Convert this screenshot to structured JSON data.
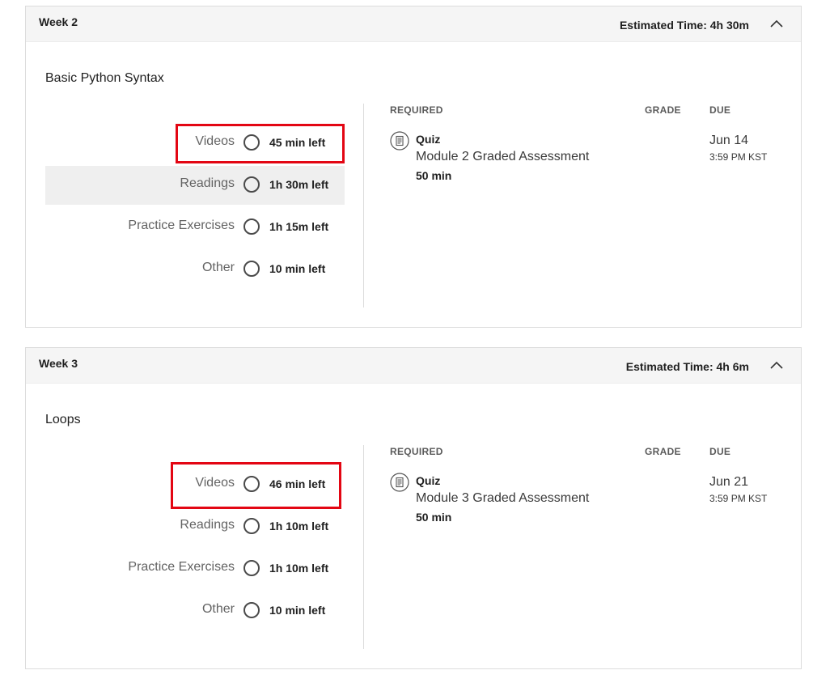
{
  "weeks": [
    {
      "title": "Week 2",
      "estimated_time": "Estimated Time: 4h 30m",
      "module_title": "Basic Python Syntax",
      "progress": [
        {
          "label": "Videos",
          "left": "45 min left"
        },
        {
          "label": "Readings",
          "left": "1h 30m left"
        },
        {
          "label": "Practice Exercises",
          "left": "1h 15m left"
        },
        {
          "label": "Other",
          "left": "10 min left"
        }
      ],
      "columns": {
        "required": "REQUIRED",
        "grade": "GRADE",
        "due": "DUE"
      },
      "item": {
        "type": "Quiz",
        "name": "Module 2 Graded Assessment",
        "duration": "50 min",
        "due_date": "Jun 14",
        "due_time": "3:59 PM KST"
      }
    },
    {
      "title": "Week 3",
      "estimated_time": "Estimated Time: 4h 6m",
      "module_title": "Loops",
      "progress": [
        {
          "label": "Videos",
          "left": "46 min left"
        },
        {
          "label": "Readings",
          "left": "1h 10m left"
        },
        {
          "label": "Practice Exercises",
          "left": "1h 10m left"
        },
        {
          "label": "Other",
          "left": "10 min left"
        }
      ],
      "columns": {
        "required": "REQUIRED",
        "grade": "GRADE",
        "due": "DUE"
      },
      "item": {
        "type": "Quiz",
        "name": "Module 3 Graded Assessment",
        "duration": "50 min",
        "due_date": "Jun 21",
        "due_time": "3:59 PM KST"
      }
    }
  ],
  "colors": {
    "highlight_box": "#e30613",
    "header_bg": "#f5f5f5",
    "hover_row": "#efefef"
  },
  "icons": {
    "collapse": "chevron-up-icon",
    "quiz": "quiz-document-icon",
    "progress": "empty-circle-icon"
  }
}
